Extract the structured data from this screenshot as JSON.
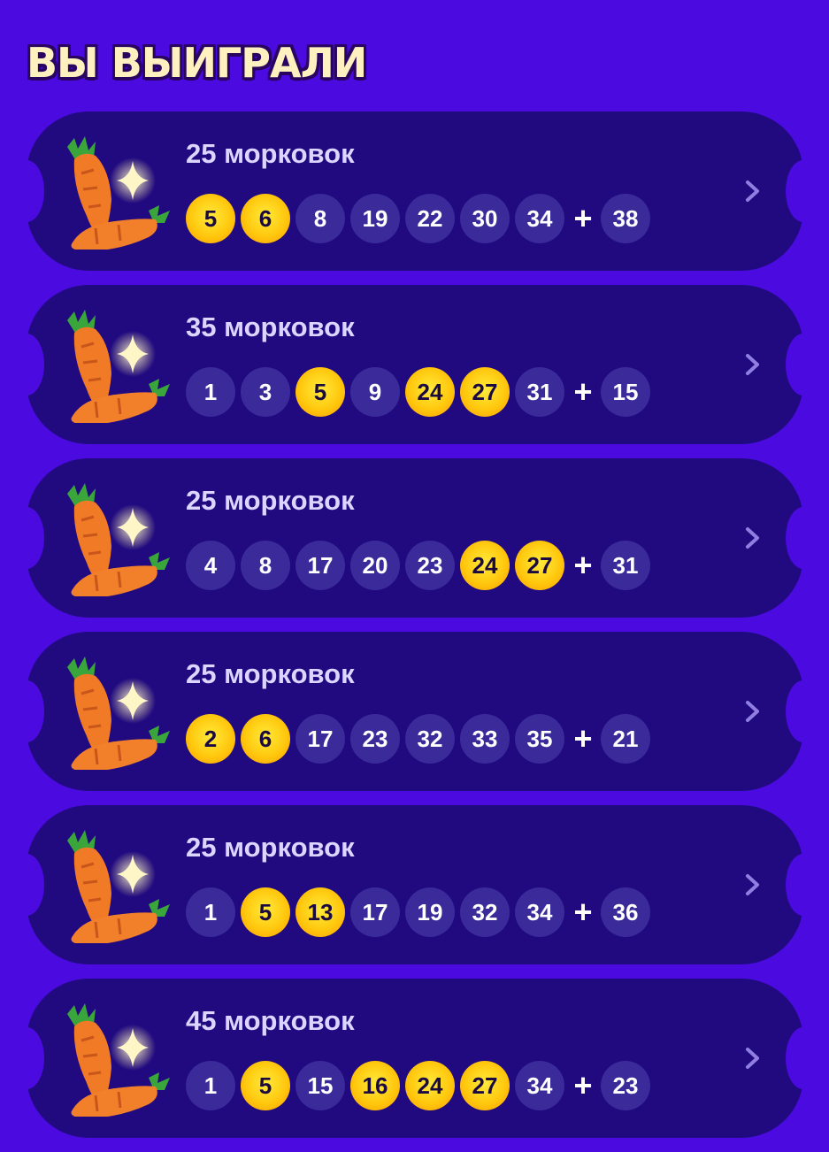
{
  "page": {
    "title": "ВЫ ВЫИГРАЛИ"
  },
  "colors": {
    "background": "#4a0ae0",
    "ticket": "#210a80",
    "ball": "#3a2a9a",
    "ball_hit": "#ffc80e",
    "title": "#fff0bf"
  },
  "tickets": [
    {
      "prize": "25 морковок",
      "icon": "carrot-icon",
      "numbers": [
        {
          "n": "5",
          "hit": true
        },
        {
          "n": "6",
          "hit": true
        },
        {
          "n": "8",
          "hit": false
        },
        {
          "n": "19",
          "hit": false
        },
        {
          "n": "22",
          "hit": false
        },
        {
          "n": "30",
          "hit": false
        },
        {
          "n": "34",
          "hit": false
        }
      ],
      "plus": "+",
      "bonus": "38"
    },
    {
      "prize": "35 морковок",
      "icon": "carrot-icon",
      "numbers": [
        {
          "n": "1",
          "hit": false
        },
        {
          "n": "3",
          "hit": false
        },
        {
          "n": "5",
          "hit": true
        },
        {
          "n": "9",
          "hit": false
        },
        {
          "n": "24",
          "hit": true
        },
        {
          "n": "27",
          "hit": true
        },
        {
          "n": "31",
          "hit": false
        }
      ],
      "plus": "+",
      "bonus": "15"
    },
    {
      "prize": "25 морковок",
      "icon": "carrot-icon",
      "numbers": [
        {
          "n": "4",
          "hit": false
        },
        {
          "n": "8",
          "hit": false
        },
        {
          "n": "17",
          "hit": false
        },
        {
          "n": "20",
          "hit": false
        },
        {
          "n": "23",
          "hit": false
        },
        {
          "n": "24",
          "hit": true
        },
        {
          "n": "27",
          "hit": true
        }
      ],
      "plus": "+",
      "bonus": "31"
    },
    {
      "prize": "25 морковок",
      "icon": "carrot-icon",
      "numbers": [
        {
          "n": "2",
          "hit": true
        },
        {
          "n": "6",
          "hit": true
        },
        {
          "n": "17",
          "hit": false
        },
        {
          "n": "23",
          "hit": false
        },
        {
          "n": "32",
          "hit": false
        },
        {
          "n": "33",
          "hit": false
        },
        {
          "n": "35",
          "hit": false
        }
      ],
      "plus": "+",
      "bonus": "21"
    },
    {
      "prize": "25 морковок",
      "icon": "carrot-icon",
      "numbers": [
        {
          "n": "1",
          "hit": false
        },
        {
          "n": "5",
          "hit": true
        },
        {
          "n": "13",
          "hit": true
        },
        {
          "n": "17",
          "hit": false
        },
        {
          "n": "19",
          "hit": false
        },
        {
          "n": "32",
          "hit": false
        },
        {
          "n": "34",
          "hit": false
        }
      ],
      "plus": "+",
      "bonus": "36"
    },
    {
      "prize": "45 морковок",
      "icon": "carrot-icon",
      "numbers": [
        {
          "n": "1",
          "hit": false
        },
        {
          "n": "5",
          "hit": true
        },
        {
          "n": "15",
          "hit": false
        },
        {
          "n": "16",
          "hit": true
        },
        {
          "n": "24",
          "hit": true
        },
        {
          "n": "27",
          "hit": true
        },
        {
          "n": "34",
          "hit": false
        }
      ],
      "plus": "+",
      "bonus": "23"
    }
  ]
}
